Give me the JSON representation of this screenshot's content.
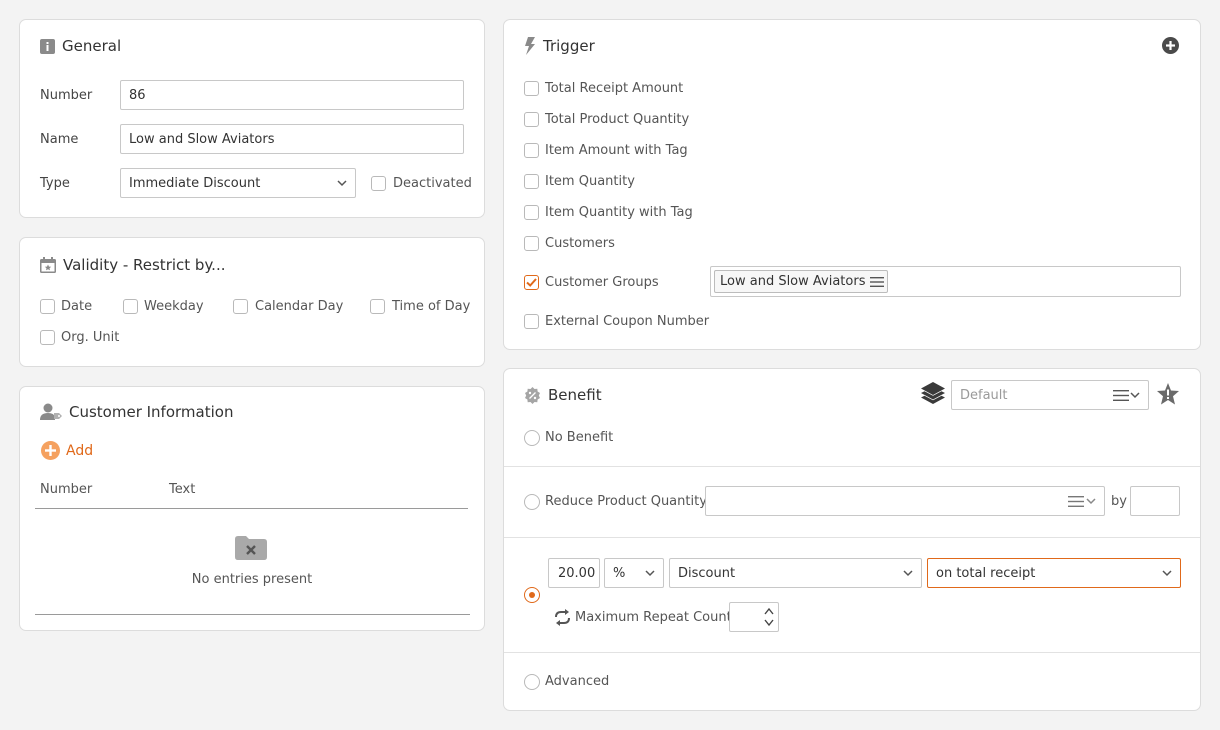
{
  "general": {
    "title": "General",
    "number_label": "Number",
    "number_value": "86",
    "name_label": "Name",
    "name_value": "Low and Slow Aviators",
    "type_label": "Type",
    "type_value": "Immediate Discount",
    "deactivated_label": "Deactivated"
  },
  "validity": {
    "title": "Validity - Restrict by...",
    "options": [
      "Date",
      "Weekday",
      "Calendar Day",
      "Time of Day",
      "Org. Unit"
    ]
  },
  "customer_info": {
    "title": "Customer Information",
    "add_label": "Add",
    "columns": [
      "Number",
      "Text"
    ],
    "empty_text": "No entries present"
  },
  "trigger": {
    "title": "Trigger",
    "options": [
      "Total Receipt Amount",
      "Total Product Quantity",
      "Item Amount with Tag",
      "Item Quantity",
      "Item Quantity with Tag",
      "Customers",
      "Customer Groups",
      "External Coupon Number"
    ],
    "checked_option": "Customer Groups",
    "customer_group_tag": "Low and Slow Aviators"
  },
  "benefit": {
    "title": "Benefit",
    "layer_placeholder": "Default",
    "no_benefit_label": "No Benefit",
    "reduce_label": "Reduce Product Quantity",
    "by_label": "by",
    "discount_value": "20.00",
    "unit_value": "%",
    "discount_type": "Discount",
    "discount_target": "on total receipt",
    "max_repeat_label": "Maximum Repeat Count",
    "advanced_label": "Advanced"
  },
  "colors": {
    "accent": "#e0691a",
    "border": "#dcdcdc",
    "background": "#f3f3f3"
  }
}
